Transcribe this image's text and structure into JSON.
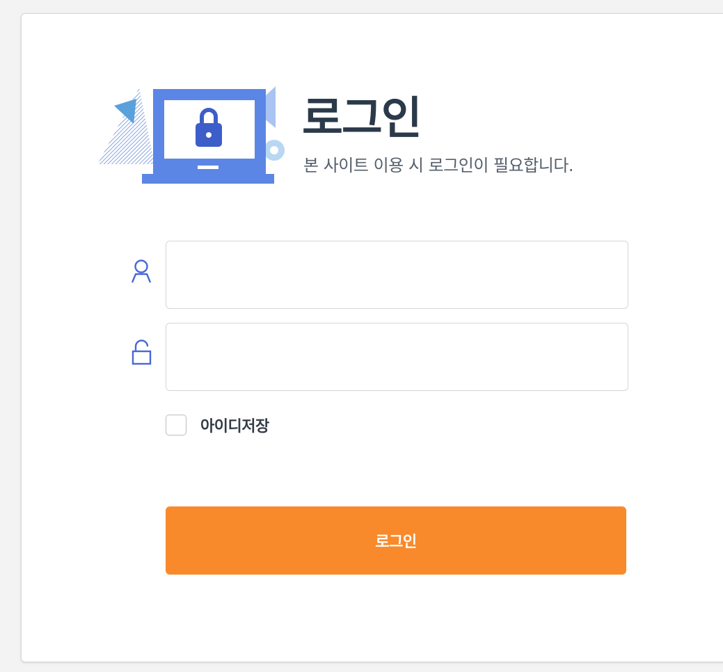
{
  "header": {
    "title": "로그인",
    "subtitle": "본 사이트 이용 시 로그인이 필요합니다."
  },
  "form": {
    "username": {
      "value": "",
      "placeholder": "",
      "icon": "user-icon"
    },
    "password": {
      "value": "",
      "placeholder": "",
      "icon": "unlock-icon"
    },
    "remember_label": "아이디저장",
    "remember_checked": false,
    "submit_label": "로그인"
  },
  "colors": {
    "accent": "#f98a2b",
    "icon_blue": "#4a67d6",
    "illustration_blue": "#5b86e5",
    "title": "#2b3a4a"
  }
}
